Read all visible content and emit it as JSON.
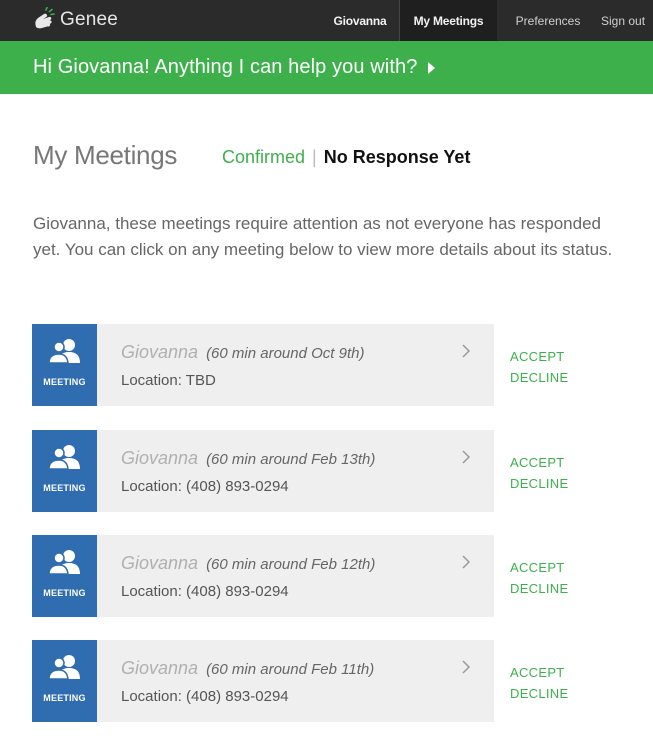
{
  "app": {
    "brand_name": "Genee",
    "nav": {
      "user": "Giovanna",
      "my_meetings": "My Meetings",
      "preferences": "Preferences",
      "sign_out": "Sign out"
    }
  },
  "banner": {
    "text": "Hi Giovanna! Anything I can help you with?"
  },
  "page": {
    "title": "My Meetings",
    "filter_confirmed": "Confirmed",
    "filter_separator": "|",
    "filter_no_response": "No Response Yet",
    "intro": "Giovanna, these meetings require attention as not everyone has responded yet. You can click on any meeting below to view more details about its status."
  },
  "meetings": [
    {
      "badge": "MEETING",
      "name": "Giovanna",
      "detail": "(60 min around Oct 9th)",
      "location": "Location: TBD",
      "accept": "ACCEPT",
      "decline": "DECLINE"
    },
    {
      "badge": "MEETING",
      "name": "Giovanna",
      "detail": "(60 min around Feb 13th)",
      "location": "Location: (408) 893-0294",
      "accept": "ACCEPT",
      "decline": "DECLINE"
    },
    {
      "badge": "MEETING",
      "name": "Giovanna",
      "detail": "(60 min around Feb 12th)",
      "location": "Location: (408) 893-0294",
      "accept": "ACCEPT",
      "decline": "DECLINE"
    },
    {
      "badge": "MEETING",
      "name": "Giovanna",
      "detail": "(60 min around Feb 11th)",
      "location": "Location: (408) 893-0294",
      "accept": "ACCEPT",
      "decline": "DECLINE"
    }
  ],
  "icons": {
    "brand_logo": "hand-snap-icon",
    "banner_arrow": "triangle-right-icon",
    "meeting_badge": "people-icon",
    "row_chevron": "chevron-right-icon"
  },
  "colors": {
    "topbar": "#2b2b2b",
    "accent_green": "#3db04c",
    "badge_blue": "#2f6db0",
    "card_bg": "#efefef"
  }
}
